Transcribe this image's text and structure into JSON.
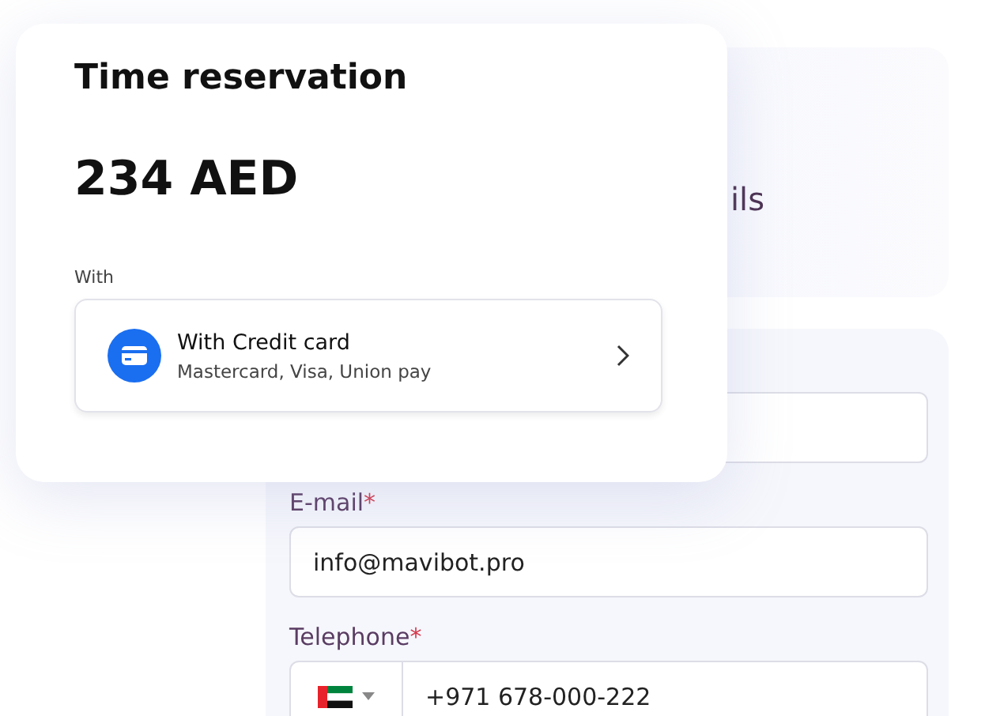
{
  "background_form": {
    "heading": "ils",
    "required_mark": "*",
    "fields": [
      {
        "kind": "text",
        "label": "E-mail",
        "required": true,
        "value": "info@mavibot.pro"
      },
      {
        "kind": "phone",
        "label": "Telephone",
        "required": true,
        "value": "+971 678-000-222"
      }
    ]
  },
  "reservation_card": {
    "title": "Time reservation",
    "price": "234 AED",
    "method_label": "With",
    "payment_option": {
      "title": "With Credit card",
      "subtitle": "Mastercard, Visa, Union pay"
    }
  }
}
